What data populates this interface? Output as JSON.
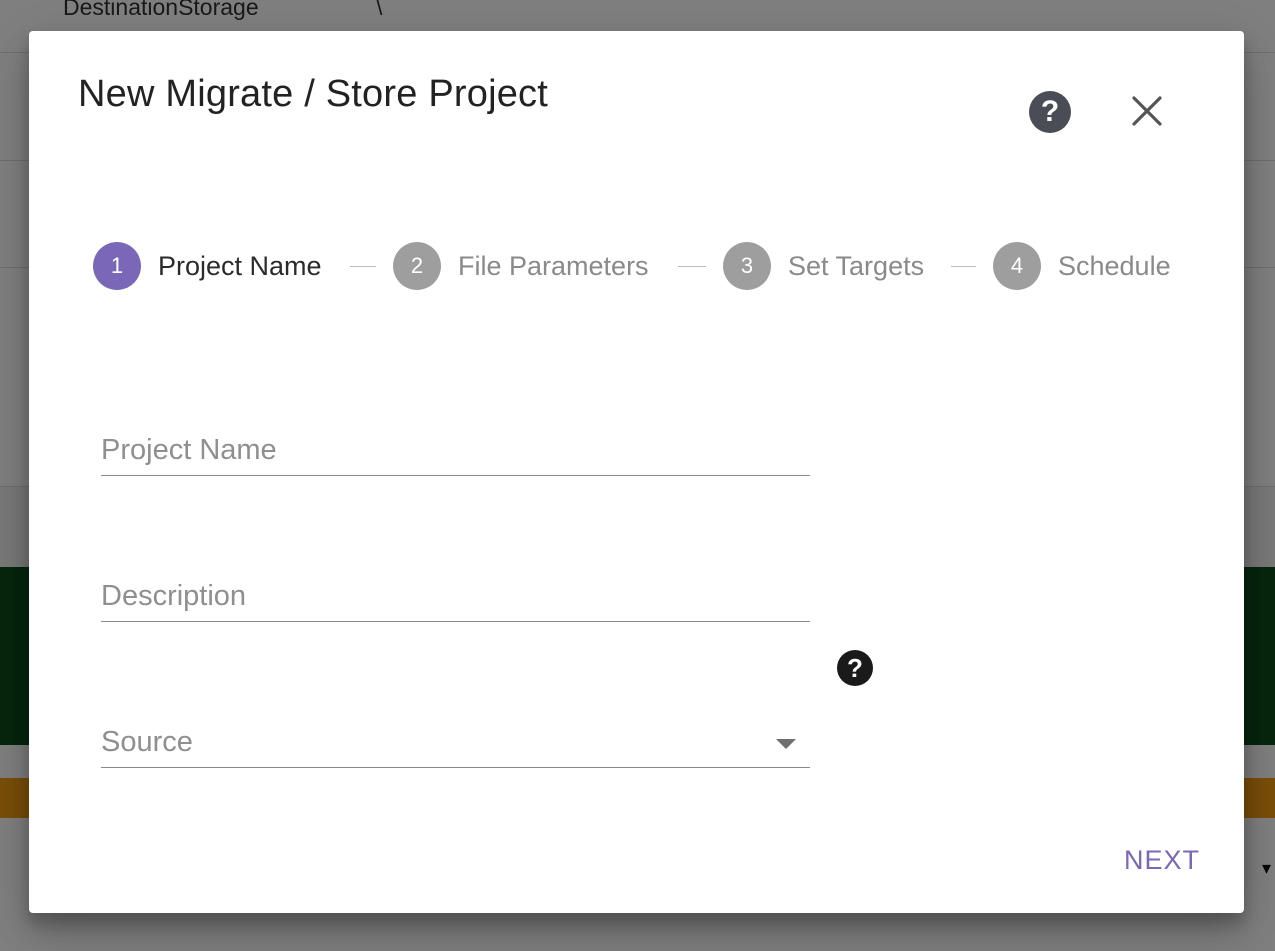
{
  "background": {
    "header_text": "DestinationStorage",
    "header_tick": "\\"
  },
  "dialog": {
    "title": "New Migrate / Store Project",
    "help_icon_glyph": "?",
    "close_icon": "close-icon"
  },
  "stepper": {
    "steps": [
      {
        "number": "1",
        "label": "Project Name",
        "active": true
      },
      {
        "number": "2",
        "label": "File Parameters",
        "active": false
      },
      {
        "number": "3",
        "label": "Set Targets",
        "active": false
      },
      {
        "number": "4",
        "label": "Schedule",
        "active": false
      }
    ]
  },
  "form": {
    "project_name": {
      "placeholder": "Project Name",
      "value": ""
    },
    "description": {
      "placeholder": "Description",
      "value": ""
    },
    "source": {
      "label": "Source",
      "value": ""
    },
    "source_help_glyph": "?"
  },
  "actions": {
    "next_label": "NEXT"
  },
  "colors": {
    "accent": "#7b67b8",
    "step_inactive": "#9e9e9e",
    "help_icon_bg": "#4a4d55"
  }
}
